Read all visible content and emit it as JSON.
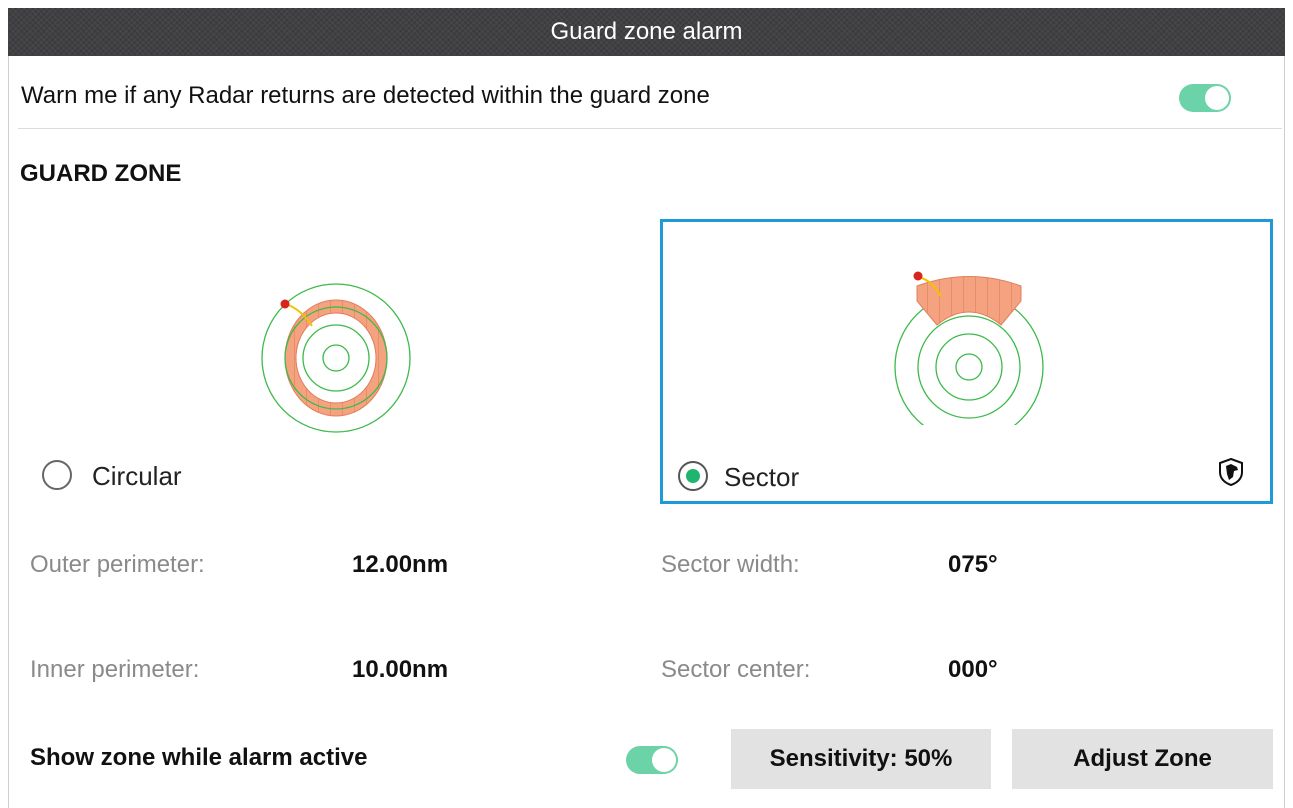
{
  "dialog": {
    "title": "Guard zone alarm"
  },
  "warn": {
    "label": "Warn me if any Radar returns are detected within the guard zone",
    "enabled": true
  },
  "guard_zone": {
    "section_title": "GUARD ZONE",
    "options": [
      {
        "label": "Circular",
        "selected": false
      },
      {
        "label": "Sector",
        "selected": true
      }
    ]
  },
  "params": {
    "outer_perimeter": {
      "label": "Outer perimeter:",
      "value": "12.00nm"
    },
    "inner_perimeter": {
      "label": "Inner perimeter:",
      "value": "10.00nm"
    },
    "sector_width": {
      "label": "Sector width:",
      "value": "075°"
    },
    "sector_center": {
      "label": "Sector center:",
      "value": "000°"
    }
  },
  "show_zone": {
    "label": "Show zone while alarm active",
    "enabled": true
  },
  "buttons": {
    "sensitivity": "Sensitivity: 50%",
    "adjust_zone": "Adjust Zone"
  },
  "colors": {
    "accent_green": "#6cd3a8",
    "selection_blue": "#1e9bd7",
    "zone_fill": "#f4a27f",
    "ring_green": "#3cba4a",
    "marker_red": "#d9261c",
    "arrow_yellow": "#f2c200"
  },
  "icons": {
    "sector_badge": "dog-head-shield-icon"
  }
}
